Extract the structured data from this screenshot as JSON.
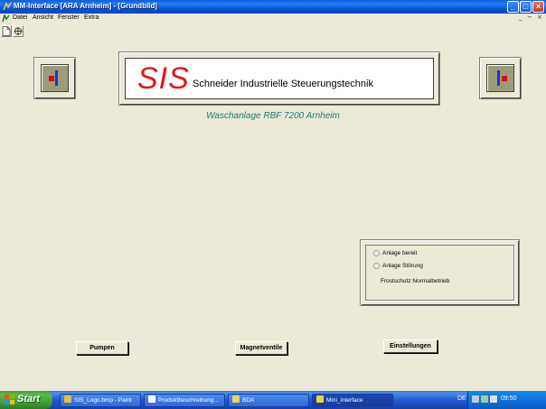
{
  "window": {
    "title": "MM-Interface [ARA Arnheim] - [Grundbild]",
    "minimize": "_",
    "maximize": "□",
    "close": "×"
  },
  "menu": {
    "items": [
      "Datei",
      "Ansicht",
      "Fenster",
      "Extra"
    ],
    "mdi_controls": [
      "_",
      "−",
      "×"
    ]
  },
  "toolbar": {
    "buttons": [
      "new-document-icon",
      "move-icon"
    ]
  },
  "header": {
    "logo_text": "SIS",
    "company": "Schneider Industrielle Steuerungstechnik",
    "subtitle": "Waschanlage RBF 7200 Arnheim"
  },
  "status": {
    "ready_label": "Anlage bereit",
    "fault_label": "Anlage Störung",
    "frost_label": "Frostschutz Normalbetrieb"
  },
  "buttons": {
    "pumps": "Pumpen",
    "valves": "Magnetventile",
    "settings": "Einstellungen"
  },
  "taskbar": {
    "start": "Start",
    "tasks": [
      {
        "label": "SIS_Logo.bmp - Paint",
        "active": false
      },
      {
        "label": "Produktbeschreibung...",
        "active": false
      },
      {
        "label": "BDA",
        "active": false
      },
      {
        "label": "Mini_interface",
        "active": true
      }
    ],
    "language": "DE",
    "clock": "09:50"
  },
  "colors": {
    "logo_red": "#E01818",
    "subtitle_teal": "#1A7A7A",
    "logo_blue": "#1A37C8"
  }
}
